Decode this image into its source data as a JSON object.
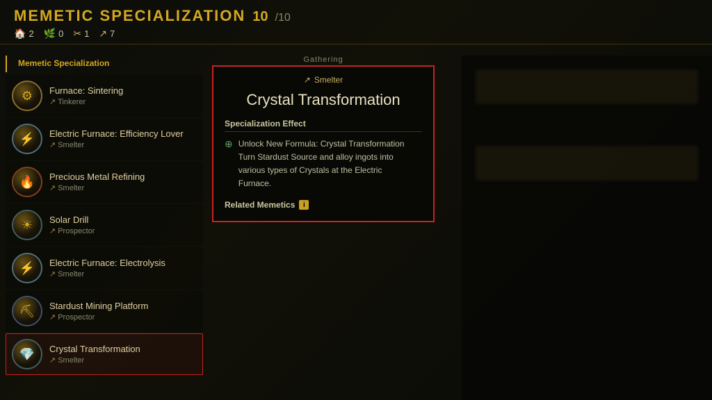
{
  "header": {
    "title": "MEMETIC SPECIALIZATION",
    "current": "10",
    "max": "/10",
    "stats": [
      {
        "icon": "🏠",
        "value": "2"
      },
      {
        "icon": "🌿",
        "value": "0"
      },
      {
        "icon": "✂",
        "value": "1"
      },
      {
        "icon": "↗",
        "value": "7"
      }
    ]
  },
  "panel_label": "Memetic Specialization",
  "skills": [
    {
      "name": "Furnace: Sintering",
      "type": "Tinkerer",
      "icon": "⚙"
    },
    {
      "name": "Electric Furnace: Efficiency Lover",
      "type": "Smelter",
      "icon": "⚡"
    },
    {
      "name": "Precious Metal Refining",
      "type": "Smelter",
      "icon": "🔥"
    },
    {
      "name": "Solar Drill",
      "type": "Prospector",
      "icon": "☀"
    },
    {
      "name": "Electric Furnace: Electrolysis",
      "type": "Smelter",
      "icon": "⚡"
    },
    {
      "name": "Stardust Mining Platform",
      "type": "Prospector",
      "icon": "⛏"
    },
    {
      "name": "Crystal Transformation",
      "type": "Smelter",
      "icon": "💎",
      "selected": true
    }
  ],
  "gathering_label": "Gathering",
  "detail": {
    "category_icon": "↗",
    "category": "Smelter",
    "title": "Crystal Transformation",
    "effect_label": "Specialization Effect",
    "effect_bullet": "⊕",
    "effect_text": "Unlock New Formula: Crystal Transformation\nTurn Stardust Source and alloy ingots into\nvarious types of Crystals at the Electric\nFurnace.",
    "related_label": "Related Memetics",
    "info_badge": "i"
  }
}
